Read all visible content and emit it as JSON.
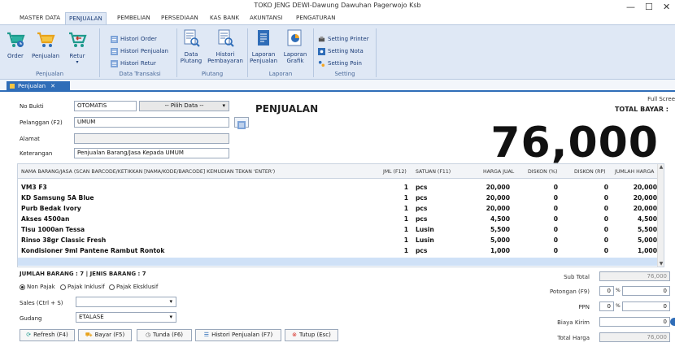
{
  "window": {
    "title": "TOKO JENG DEWI-Dawung Dawuhan Pagerwojo Ksb",
    "minimize": "—",
    "maximize": "☐",
    "close": "✕"
  },
  "menu_tabs": [
    "MASTER DATA",
    "PENJUALAN",
    "PEMBELIAN",
    "PERSEDIAAN",
    "KAS BANK",
    "AKUNTANSI",
    "PENGATURAN"
  ],
  "ribbon": {
    "big_buttons": {
      "order": "Order",
      "penjualan": "Penjualan",
      "retur": "Retur",
      "data_plutang_1": "Data",
      "data_plutang_2": "Plutang",
      "histori_pembayaran_1": "Histori",
      "histori_pembayaran_2": "Pembayaran",
      "laporan_penjualan_1": "Laporan",
      "laporan_penjualan_2": "Penjualan",
      "laporan_grafik_1": "Laporan",
      "laporan_grafik_2": "Grafik"
    },
    "small_buttons": {
      "histori_order": "Histori Order",
      "histori_penjualan": "Histori Penjualan",
      "histori_retur": "Histori Retur",
      "setting_printer": "Setting Printer",
      "setting_nota": "Setting Nota",
      "setting_poin": "Setting Poin"
    },
    "groups": {
      "penjualan": "Penjualan",
      "data_transaksi": "Data Transaksi",
      "piutang": "Piutang",
      "laporan": "Laporan",
      "setting": "Setting"
    }
  },
  "doc_tab": {
    "label": "Penjualan",
    "close": "✕"
  },
  "form": {
    "no_bukti_label": "No Bukti",
    "no_bukti_value": "OTOMATIS",
    "pilih_data": "-- Pilih Data --",
    "title": "PENJUALAN",
    "pelanggan_label": "Pelanggan (F2)",
    "pelanggan_value": "UMUM",
    "alamat_label": "Alamat",
    "alamat_value": "",
    "keterangan_label": "Keterangan",
    "keterangan_value": "Penjualan Barang/Jasa Kepada UMUM",
    "full_screen": "Full Scree",
    "total_bayar_label": "TOTAL BAYAR :",
    "total_bayar_value": "76,000"
  },
  "grid": {
    "headers": {
      "nama": "NAMA BARANG/JASA (SCAN BARCODE/KETIKKAN [NAMA/KODE/BARCODE] KEMUDIAN TEKAN 'ENTER')",
      "jml": "JML (F12)",
      "satuan": "SATUAN (F11)",
      "harga": "HARGA JUAL",
      "diskon_pct": "DISKON (%)",
      "diskon_rp": "DISKON (RP)",
      "jumlah": "JUMLAH HARGA"
    },
    "rows": [
      {
        "nama": "VM3 F3",
        "jml": "1",
        "satuan": "pcs",
        "harga": "20,000",
        "diskon_pct": "0",
        "diskon_rp": "0",
        "jumlah": "20,000"
      },
      {
        "nama": "KD Samsung 5A Blue",
        "jml": "1",
        "satuan": "pcs",
        "harga": "20,000",
        "diskon_pct": "0",
        "diskon_rp": "0",
        "jumlah": "20,000"
      },
      {
        "nama": "Purb Bedak Ivory",
        "jml": "1",
        "satuan": "pcs",
        "harga": "20,000",
        "diskon_pct": "0",
        "diskon_rp": "0",
        "jumlah": "20,000"
      },
      {
        "nama": "Akses 4500an",
        "jml": "1",
        "satuan": "pcs",
        "harga": "4,500",
        "diskon_pct": "0",
        "diskon_rp": "0",
        "jumlah": "4,500"
      },
      {
        "nama": "Tisu 1000an Tessa",
        "jml": "1",
        "satuan": "Lusin",
        "harga": "5,500",
        "diskon_pct": "0",
        "diskon_rp": "0",
        "jumlah": "5,500"
      },
      {
        "nama": "Rinso 38gr Classic Fresh",
        "jml": "1",
        "satuan": "Lusin",
        "harga": "5,000",
        "diskon_pct": "0",
        "diskon_rp": "0",
        "jumlah": "5,000"
      },
      {
        "nama": "Kondisioner 9ml Pantene Rambut Rontok",
        "jml": "1",
        "satuan": "pcs",
        "harga": "1,000",
        "diskon_pct": "0",
        "diskon_rp": "0",
        "jumlah": "1,000"
      }
    ]
  },
  "summary": "JUMLAH BARANG : 7 | JENIS BARANG : 7",
  "pajak": {
    "non_pajak": "Non Pajak",
    "inklusif": "Pajak Inklusif",
    "eksklusif": "Pajak Eksklusif"
  },
  "sales_label": "Sales (Ctrl + S)",
  "sales_value": "",
  "gudang_label": "Gudang",
  "gudang_value": "ETALASE",
  "buttons": {
    "refresh": "Refresh (F4)",
    "bayar": "Bayar (F5)",
    "tunda": "Tunda (F6)",
    "histori": "Histori Penjualan (F7)",
    "tutup": "Tutup (Esc)"
  },
  "totals": {
    "sub_total_label": "Sub Total",
    "sub_total_value": "76,000",
    "potongan_label": "Potongan (F9)",
    "potongan_pct": "0",
    "pct_sign": "%",
    "potongan_value": "0",
    "ppn_label": "PPN",
    "ppn_pct": "0",
    "ppn_value": "0",
    "biaya_kirim_label": "Biaya Kirim",
    "biaya_kirim_value": "0",
    "total_harga_label": "Total Harga",
    "total_harga_value": "76,000"
  },
  "colors": {
    "ribbon_bg": "#dfe8f5",
    "accent_blue": "#2f6db8",
    "selected_row": "#cfe1f7"
  }
}
